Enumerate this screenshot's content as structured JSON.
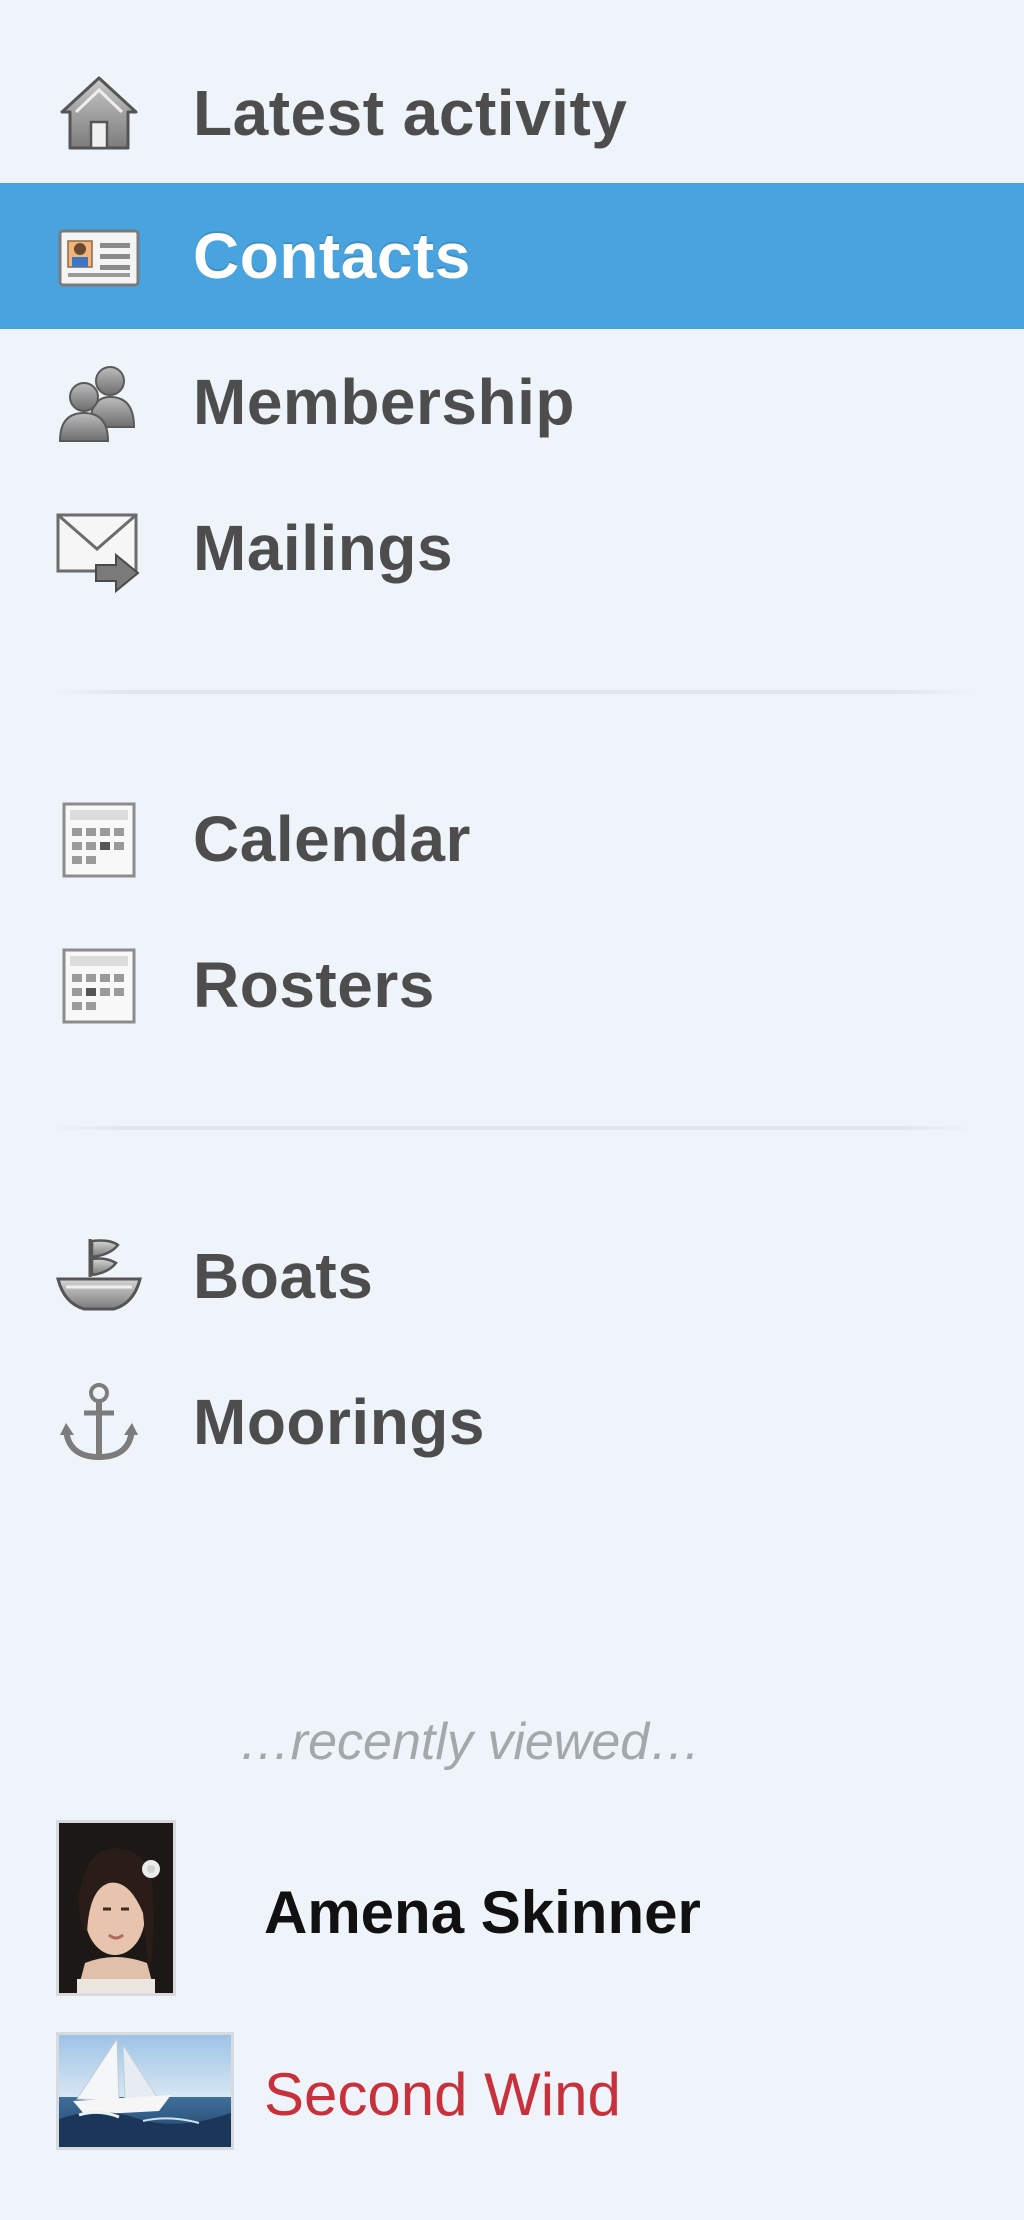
{
  "nav": {
    "group1": [
      {
        "label": "Latest activity",
        "icon": "home-icon",
        "active": false
      },
      {
        "label": "Contacts",
        "icon": "contact-card-icon",
        "active": true
      },
      {
        "label": "Membership",
        "icon": "people-icon",
        "active": false
      },
      {
        "label": "Mailings",
        "icon": "mail-forward-icon",
        "active": false
      }
    ],
    "group2": [
      {
        "label": "Calendar",
        "icon": "calendar-icon",
        "active": false
      },
      {
        "label": "Rosters",
        "icon": "roster-icon",
        "active": false
      }
    ],
    "group3": [
      {
        "label": "Boats",
        "icon": "boat-icon",
        "active": false
      },
      {
        "label": "Moorings",
        "icon": "anchor-icon",
        "active": false
      }
    ]
  },
  "recent": {
    "heading": "…recently viewed…",
    "items": [
      {
        "label": "Amena Skinner",
        "type": "contact"
      },
      {
        "label": "Second Wind",
        "type": "boat"
      }
    ]
  },
  "colors": {
    "background": "#eef4fa",
    "active_bg": "#48a3df",
    "label": "#4d4d4d",
    "boat_link": "#c8303c"
  }
}
